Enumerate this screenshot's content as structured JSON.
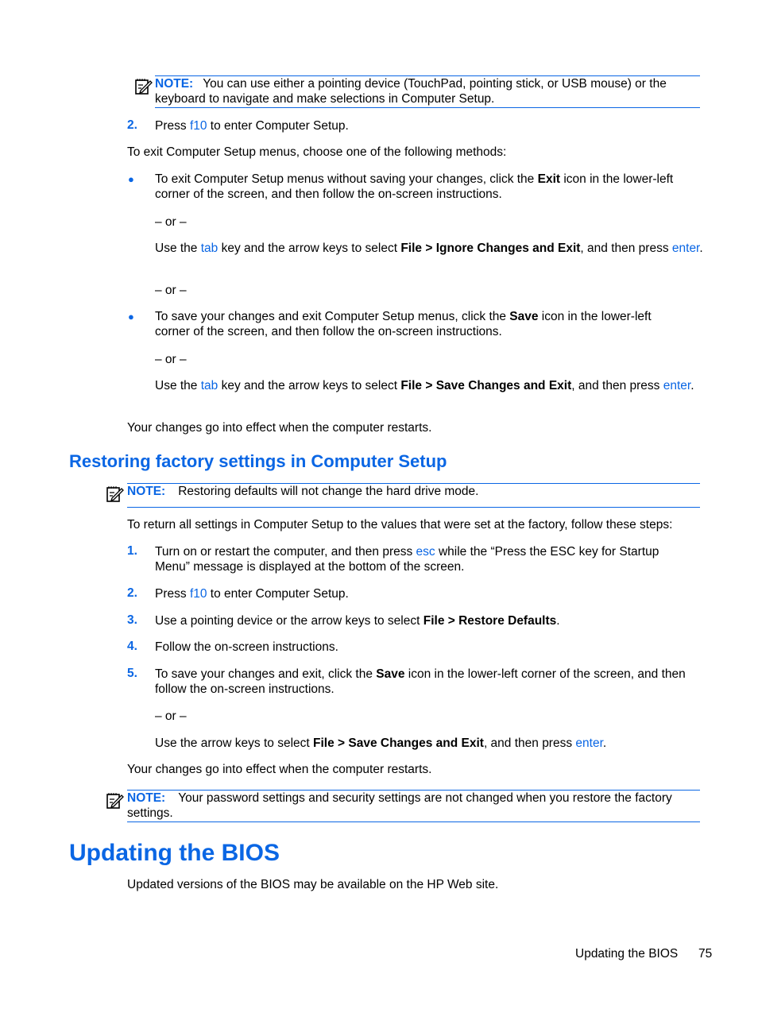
{
  "note1": {
    "label": "NOTE:",
    "text": "You can use either a pointing device (TouchPad, pointing stick, or USB mouse) or the keyboard to navigate and make selections in Computer Setup."
  },
  "step2_top": {
    "num": "2.",
    "pre": "Press ",
    "key": "f10",
    "post": " to enter Computer Setup."
  },
  "exit_intro": "To exit Computer Setup menus, choose one of the following methods:",
  "bullet1": {
    "pre": "To exit Computer Setup menus without saving your changes, click the ",
    "bold": "Exit",
    "post": " icon in the lower-left corner of the screen, and then follow the on-screen instructions.",
    "or": "– or –",
    "alt_pre": "Use the ",
    "alt_key1": "tab",
    "alt_mid": " key and the arrow keys to select ",
    "alt_bold": "File > Ignore Changes and Exit",
    "alt_post": ", and then press ",
    "alt_key2": "enter",
    "alt_end": "."
  },
  "or_between": "– or –",
  "bullet2": {
    "pre": "To save your changes and exit Computer Setup menus, click the ",
    "bold": "Save",
    "post": " icon in the lower-left corner of the screen, and then follow the on-screen instructions.",
    "or": "– or –",
    "alt_pre": "Use the ",
    "alt_key1": "tab",
    "alt_mid": " key and the arrow keys to select ",
    "alt_bold": "File > Save Changes and Exit",
    "alt_post": ", and then press ",
    "alt_key2": "enter",
    "alt_end": "."
  },
  "effect1": "Your changes go into effect when the computer restarts.",
  "section_heading": "Restoring factory settings in Computer Setup",
  "note2": {
    "label": "NOTE:",
    "text": "Restoring defaults will not change the hard drive mode."
  },
  "restore_intro": "To return all settings in Computer Setup to the values that were set at the factory, follow these steps:",
  "steps": [
    {
      "num": "1.",
      "pre": "Turn on or restart the computer, and then press ",
      "key": "esc",
      "post": " while the “Press the ESC key for Startup Menu” message is displayed at the bottom of the screen."
    },
    {
      "num": "2.",
      "pre": "Press ",
      "key": "f10",
      "post": " to enter Computer Setup."
    },
    {
      "num": "3.",
      "pre": "Use a pointing device or the arrow keys to select ",
      "bold": "File > Restore Defaults",
      "post": "."
    },
    {
      "num": "4.",
      "text": "Follow the on-screen instructions."
    },
    {
      "num": "5.",
      "pre": "To save your changes and exit, click the ",
      "bold": "Save",
      "post": " icon in the lower-left corner of the screen, and then follow the on-screen instructions.",
      "or": "– or –",
      "alt_pre": "Use the arrow keys to select ",
      "alt_bold": "File > Save Changes and Exit",
      "alt_post": ", and then press ",
      "alt_key": "enter",
      "alt_end": "."
    }
  ],
  "effect2": "Your changes go into effect when the computer restarts.",
  "note3": {
    "label": "NOTE:",
    "text": "Your password settings and security settings are not changed when you restore the factory settings."
  },
  "chapter_heading": "Updating the BIOS",
  "bios_intro": "Updated versions of the BIOS may be available on the HP Web site.",
  "footer": {
    "section": "Updating the BIOS",
    "page": "75"
  }
}
